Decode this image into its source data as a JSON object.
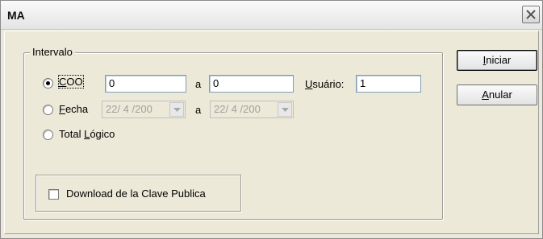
{
  "window": {
    "title": "MA"
  },
  "group": {
    "legend": "Intervalo"
  },
  "coo": {
    "label_underlined": "C",
    "label_rest": "OO",
    "from": "0",
    "separator": "a",
    "to": "0",
    "selected": true
  },
  "usuario": {
    "label_underlined": "U",
    "label_rest": "suário:",
    "value": "1"
  },
  "fecha": {
    "label_underlined": "F",
    "label_rest": "echa",
    "from": "22/ 4 /200",
    "separator": "a",
    "to": "22/ 4 /200"
  },
  "total": {
    "label_prefix": "Total ",
    "label_underlined": "L",
    "label_rest": "ógico"
  },
  "download": {
    "label": "Download de la Clave Publica",
    "checked": false
  },
  "buttons": {
    "iniciar": {
      "underlined": "I",
      "rest": "niciar"
    },
    "anular": {
      "underlined": "A",
      "rest": "nular"
    }
  },
  "icons": {
    "close": "close-icon",
    "combo": "chevron-down-icon"
  }
}
